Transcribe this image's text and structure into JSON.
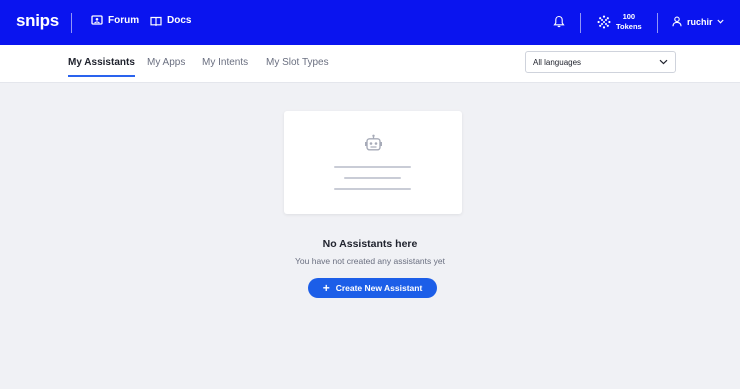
{
  "header": {
    "logo": "snips",
    "nav": [
      {
        "label": "Forum",
        "icon": "forum-icon"
      },
      {
        "label": "Docs",
        "icon": "docs-icon"
      }
    ],
    "tokens": {
      "count": "100",
      "label": "Tokens"
    },
    "user": {
      "name": "ruchir"
    }
  },
  "tabs": [
    {
      "label": "My Assistants",
      "active": true
    },
    {
      "label": "My Apps",
      "active": false
    },
    {
      "label": "My Intents",
      "active": false
    },
    {
      "label": "My Slot Types",
      "active": false
    }
  ],
  "language_select": {
    "value": "All languages"
  },
  "empty_state": {
    "title": "No Assistants here",
    "subtitle": "You have not created any assistants yet",
    "button_label": "Create New Assistant",
    "button_icon": "plus-icon"
  },
  "colors": {
    "header_bg": "#0a14ef",
    "accent": "#1c5ee8",
    "page_bg": "#f0f1f5"
  }
}
